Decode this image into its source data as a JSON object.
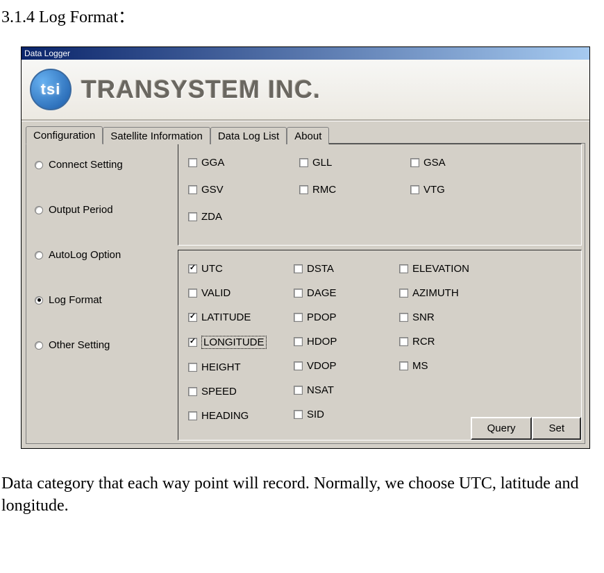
{
  "doc": {
    "heading": "3.1.4 Log Format：",
    "footer": "Data category that each way point will record. Normally, we choose UTC, latitude and longitude."
  },
  "window": {
    "title": "Data Logger",
    "brand_text": "TRANSYSTEM INC.",
    "logo_text": "tsi"
  },
  "tabs": [
    {
      "label": "Configuration",
      "active": true
    },
    {
      "label": "Satellite Information",
      "active": false
    },
    {
      "label": "Data Log List",
      "active": false
    },
    {
      "label": "About",
      "active": false
    }
  ],
  "sidebar": [
    {
      "label": "Connect Setting",
      "selected": false
    },
    {
      "label": "Output Period",
      "selected": false
    },
    {
      "label": "AutoLog Option",
      "selected": false
    },
    {
      "label": "Log Format",
      "selected": true
    },
    {
      "label": "Other Setting",
      "selected": false
    }
  ],
  "nmea": [
    {
      "label": "GGA",
      "checked": false
    },
    {
      "label": "GLL",
      "checked": false
    },
    {
      "label": "GSA",
      "checked": false
    },
    {
      "label": "GSV",
      "checked": false
    },
    {
      "label": "RMC",
      "checked": false
    },
    {
      "label": "VTG",
      "checked": false
    },
    {
      "label": "ZDA",
      "checked": false
    }
  ],
  "fields_col1": [
    {
      "label": "UTC",
      "checked": true,
      "focus": false
    },
    {
      "label": "VALID",
      "checked": false,
      "focus": false
    },
    {
      "label": "LATITUDE",
      "checked": true,
      "focus": false
    },
    {
      "label": "LONGITUDE",
      "checked": true,
      "focus": true
    },
    {
      "label": "HEIGHT",
      "checked": false,
      "focus": false
    },
    {
      "label": "SPEED",
      "checked": false,
      "focus": false
    },
    {
      "label": "HEADING",
      "checked": false,
      "focus": false
    }
  ],
  "fields_col2": [
    {
      "label": "DSTA",
      "checked": false
    },
    {
      "label": "DAGE",
      "checked": false
    },
    {
      "label": "PDOP",
      "checked": false
    },
    {
      "label": "HDOP",
      "checked": false
    },
    {
      "label": "VDOP",
      "checked": false
    },
    {
      "label": "NSAT",
      "checked": false
    },
    {
      "label": "SID",
      "checked": false
    }
  ],
  "fields_col3": [
    {
      "label": "ELEVATION",
      "checked": false
    },
    {
      "label": "AZIMUTH",
      "checked": false
    },
    {
      "label": "SNR",
      "checked": false
    },
    {
      "label": "RCR",
      "checked": false
    },
    {
      "label": "MS",
      "checked": false
    }
  ],
  "buttons": {
    "query": "Query",
    "set": "Set"
  }
}
